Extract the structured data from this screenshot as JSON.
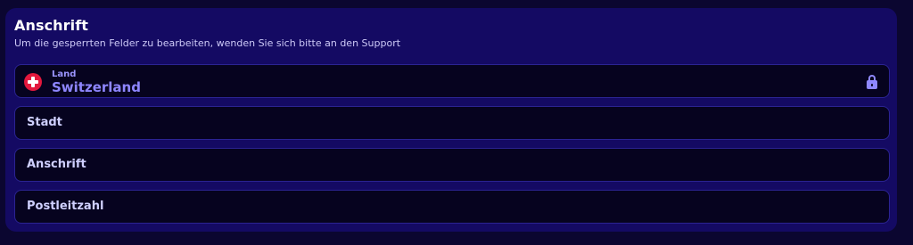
{
  "section": {
    "title": "Anschrift",
    "subtitle": "Um die gesperrten Felder zu bearbeiten, wenden Sie sich bitte an den Support"
  },
  "country_field": {
    "label": "Land",
    "value": "Switzerland",
    "flag_icon": "switzerland-flag-icon",
    "lock_icon": "lock-icon",
    "locked": true
  },
  "fields": {
    "city": "Stadt",
    "address": "Anschrift",
    "postcode": "Postleitzahl"
  },
  "colors": {
    "page_background": "#0b0630",
    "panel_background": "#140a63",
    "field_background": "#06031f",
    "field_border": "#2b2392",
    "accent": "#8e86ff",
    "flag_red": "#e3183d"
  }
}
